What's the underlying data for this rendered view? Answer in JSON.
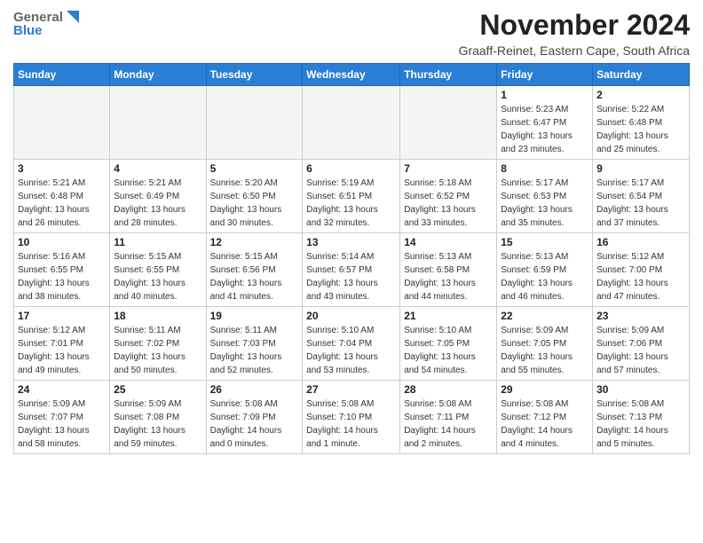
{
  "logo": {
    "general": "General",
    "blue": "Blue"
  },
  "header": {
    "month": "November 2024",
    "location": "Graaff-Reinet, Eastern Cape, South Africa"
  },
  "weekdays": [
    "Sunday",
    "Monday",
    "Tuesday",
    "Wednesday",
    "Thursday",
    "Friday",
    "Saturday"
  ],
  "weeks": [
    [
      {
        "day": "",
        "info": ""
      },
      {
        "day": "",
        "info": ""
      },
      {
        "day": "",
        "info": ""
      },
      {
        "day": "",
        "info": ""
      },
      {
        "day": "",
        "info": ""
      },
      {
        "day": "1",
        "info": "Sunrise: 5:23 AM\nSunset: 6:47 PM\nDaylight: 13 hours\nand 23 minutes."
      },
      {
        "day": "2",
        "info": "Sunrise: 5:22 AM\nSunset: 6:48 PM\nDaylight: 13 hours\nand 25 minutes."
      }
    ],
    [
      {
        "day": "3",
        "info": "Sunrise: 5:21 AM\nSunset: 6:48 PM\nDaylight: 13 hours\nand 26 minutes."
      },
      {
        "day": "4",
        "info": "Sunrise: 5:21 AM\nSunset: 6:49 PM\nDaylight: 13 hours\nand 28 minutes."
      },
      {
        "day": "5",
        "info": "Sunrise: 5:20 AM\nSunset: 6:50 PM\nDaylight: 13 hours\nand 30 minutes."
      },
      {
        "day": "6",
        "info": "Sunrise: 5:19 AM\nSunset: 6:51 PM\nDaylight: 13 hours\nand 32 minutes."
      },
      {
        "day": "7",
        "info": "Sunrise: 5:18 AM\nSunset: 6:52 PM\nDaylight: 13 hours\nand 33 minutes."
      },
      {
        "day": "8",
        "info": "Sunrise: 5:17 AM\nSunset: 6:53 PM\nDaylight: 13 hours\nand 35 minutes."
      },
      {
        "day": "9",
        "info": "Sunrise: 5:17 AM\nSunset: 6:54 PM\nDaylight: 13 hours\nand 37 minutes."
      }
    ],
    [
      {
        "day": "10",
        "info": "Sunrise: 5:16 AM\nSunset: 6:55 PM\nDaylight: 13 hours\nand 38 minutes."
      },
      {
        "day": "11",
        "info": "Sunrise: 5:15 AM\nSunset: 6:55 PM\nDaylight: 13 hours\nand 40 minutes."
      },
      {
        "day": "12",
        "info": "Sunrise: 5:15 AM\nSunset: 6:56 PM\nDaylight: 13 hours\nand 41 minutes."
      },
      {
        "day": "13",
        "info": "Sunrise: 5:14 AM\nSunset: 6:57 PM\nDaylight: 13 hours\nand 43 minutes."
      },
      {
        "day": "14",
        "info": "Sunrise: 5:13 AM\nSunset: 6:58 PM\nDaylight: 13 hours\nand 44 minutes."
      },
      {
        "day": "15",
        "info": "Sunrise: 5:13 AM\nSunset: 6:59 PM\nDaylight: 13 hours\nand 46 minutes."
      },
      {
        "day": "16",
        "info": "Sunrise: 5:12 AM\nSunset: 7:00 PM\nDaylight: 13 hours\nand 47 minutes."
      }
    ],
    [
      {
        "day": "17",
        "info": "Sunrise: 5:12 AM\nSunset: 7:01 PM\nDaylight: 13 hours\nand 49 minutes."
      },
      {
        "day": "18",
        "info": "Sunrise: 5:11 AM\nSunset: 7:02 PM\nDaylight: 13 hours\nand 50 minutes."
      },
      {
        "day": "19",
        "info": "Sunrise: 5:11 AM\nSunset: 7:03 PM\nDaylight: 13 hours\nand 52 minutes."
      },
      {
        "day": "20",
        "info": "Sunrise: 5:10 AM\nSunset: 7:04 PM\nDaylight: 13 hours\nand 53 minutes."
      },
      {
        "day": "21",
        "info": "Sunrise: 5:10 AM\nSunset: 7:05 PM\nDaylight: 13 hours\nand 54 minutes."
      },
      {
        "day": "22",
        "info": "Sunrise: 5:09 AM\nSunset: 7:05 PM\nDaylight: 13 hours\nand 55 minutes."
      },
      {
        "day": "23",
        "info": "Sunrise: 5:09 AM\nSunset: 7:06 PM\nDaylight: 13 hours\nand 57 minutes."
      }
    ],
    [
      {
        "day": "24",
        "info": "Sunrise: 5:09 AM\nSunset: 7:07 PM\nDaylight: 13 hours\nand 58 minutes."
      },
      {
        "day": "25",
        "info": "Sunrise: 5:09 AM\nSunset: 7:08 PM\nDaylight: 13 hours\nand 59 minutes."
      },
      {
        "day": "26",
        "info": "Sunrise: 5:08 AM\nSunset: 7:09 PM\nDaylight: 14 hours\nand 0 minutes."
      },
      {
        "day": "27",
        "info": "Sunrise: 5:08 AM\nSunset: 7:10 PM\nDaylight: 14 hours\nand 1 minute."
      },
      {
        "day": "28",
        "info": "Sunrise: 5:08 AM\nSunset: 7:11 PM\nDaylight: 14 hours\nand 2 minutes."
      },
      {
        "day": "29",
        "info": "Sunrise: 5:08 AM\nSunset: 7:12 PM\nDaylight: 14 hours\nand 4 minutes."
      },
      {
        "day": "30",
        "info": "Sunrise: 5:08 AM\nSunset: 7:13 PM\nDaylight: 14 hours\nand 5 minutes."
      }
    ]
  ]
}
